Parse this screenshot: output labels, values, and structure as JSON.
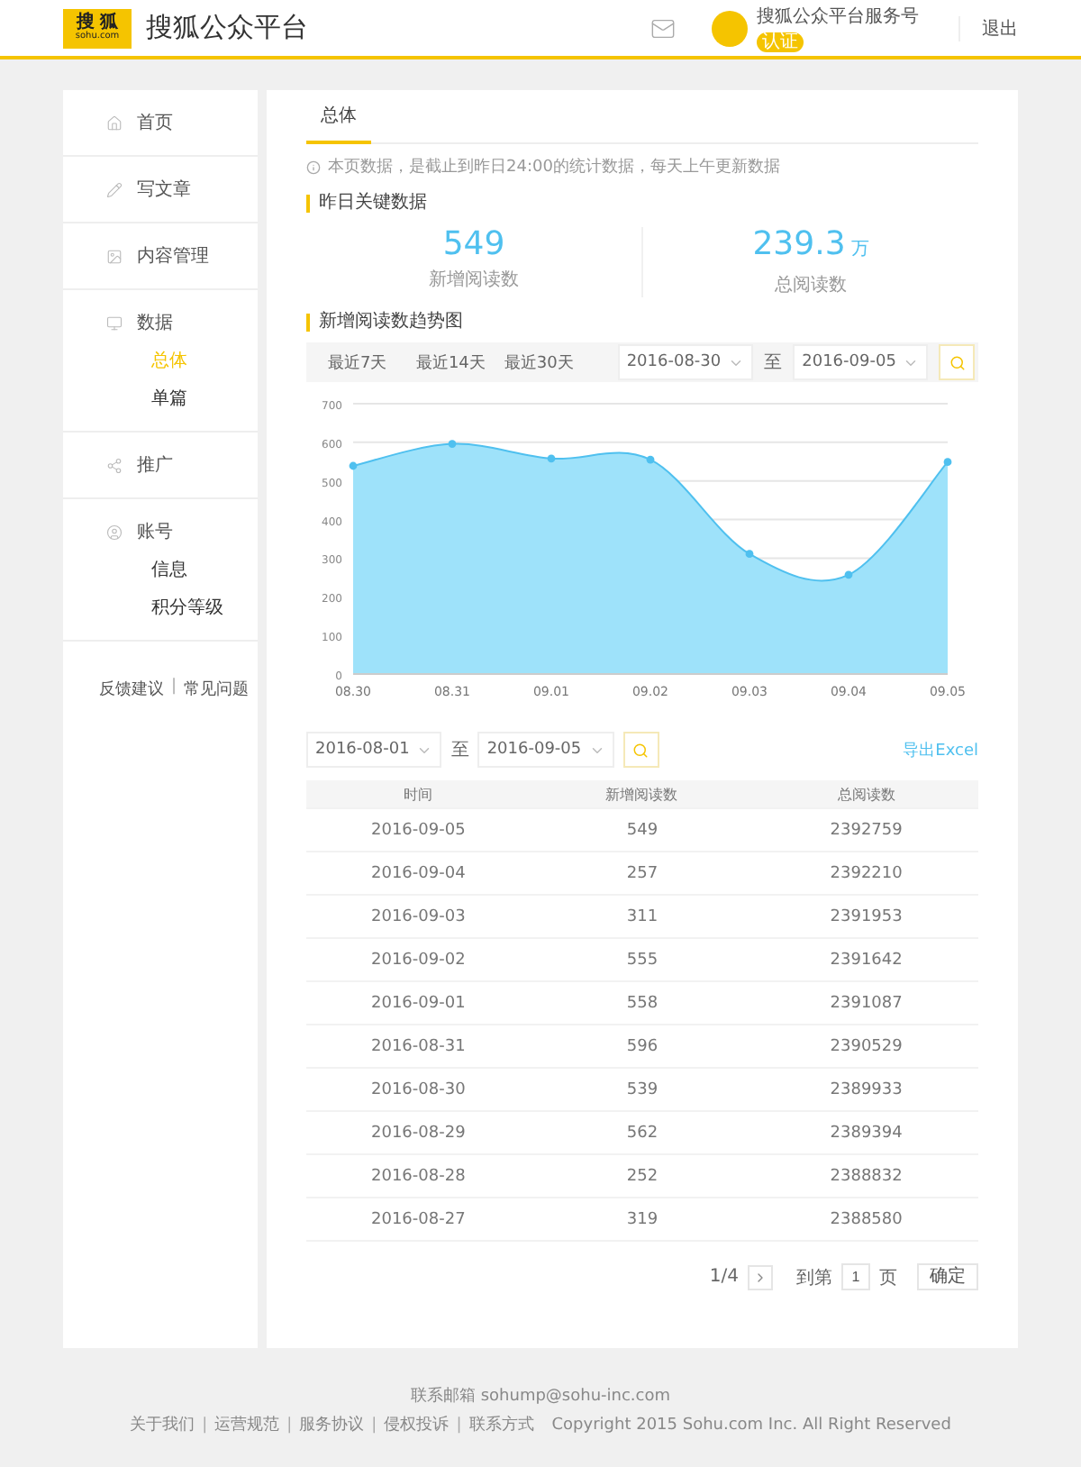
{
  "header": {
    "logo": {
      "top": "搜 狐",
      "bottom": "sohu.com"
    },
    "title": "搜狐公众平台",
    "account": {
      "name": "搜狐公众平台服务号",
      "badge": "认证"
    },
    "logout": "退出"
  },
  "sidebar": {
    "items": [
      {
        "label": "首页",
        "selected": false
      },
      {
        "label": "写文章",
        "selected": false
      },
      {
        "label": "内容管理",
        "selected": false
      },
      {
        "label": "数据",
        "selected": false,
        "children": [
          {
            "label": "总体",
            "selected": true
          },
          {
            "label": "单篇",
            "selected": false
          }
        ]
      },
      {
        "label": "推广",
        "selected": false
      },
      {
        "label": "账号",
        "selected": false,
        "children": [
          {
            "label": "信息",
            "selected": false
          },
          {
            "label": "积分等级",
            "selected": false
          }
        ]
      }
    ],
    "links": [
      "反馈建议",
      "常见问题"
    ],
    "separator": "|"
  },
  "tabs": [
    {
      "label": "总体",
      "selected": true
    }
  ],
  "notice": "本页数据，是截止到昨日24:00的统计数据，每天上午更新数据",
  "key_data": {
    "heading": "昨日关键数据",
    "stats": [
      {
        "value": "549",
        "label": "新增阅读数"
      },
      {
        "value": "239.3",
        "unit": "万",
        "label": "总阅读数"
      }
    ]
  },
  "trend": {
    "heading": "新增阅读数趋势图",
    "quick_ranges": [
      "最近7天",
      "最近14天",
      "最近30天"
    ],
    "from": "2016-08-30",
    "separator": "至",
    "to": "2016-09-05",
    "chart_data": {
      "type": "area",
      "categories": [
        "08.30",
        "08.31",
        "09.01",
        "09.02",
        "09.03",
        "09.04",
        "09.05"
      ],
      "series": [
        {
          "color": "#9ee2fa",
          "values": [
            539,
            596,
            558,
            555,
            311,
            257,
            549
          ]
        }
      ],
      "grid": true,
      "ylim": [
        0,
        700
      ],
      "yticks": [
        0,
        100,
        200,
        300,
        400,
        500,
        600,
        700
      ]
    }
  },
  "table_controls": {
    "from": "2016-08-01",
    "separator": "至",
    "to": "2016-09-05",
    "export": "导出Excel"
  },
  "table": {
    "columns": [
      "时间",
      "新增阅读数",
      "总阅读数"
    ],
    "rows": [
      [
        "2016-09-05",
        "549",
        "2392759"
      ],
      [
        "2016-09-04",
        "257",
        "2392210"
      ],
      [
        "2016-09-03",
        "311",
        "2391953"
      ],
      [
        "2016-09-02",
        "555",
        "2391642"
      ],
      [
        "2016-09-01",
        "558",
        "2391087"
      ],
      [
        "2016-08-31",
        "596",
        "2390529"
      ],
      [
        "2016-08-30",
        "539",
        "2389933"
      ],
      [
        "2016-08-29",
        "562",
        "2389394"
      ],
      [
        "2016-08-28",
        "252",
        "2388832"
      ],
      [
        "2016-08-27",
        "319",
        "2388580"
      ]
    ]
  },
  "pagination": {
    "page": "1/4",
    "goto": "到第",
    "input": "1",
    "unit": "页",
    "confirm": "确定"
  },
  "footer": {
    "contact": "联系邮箱 sohump@sohu-inc.com",
    "links": [
      "关于我们",
      "运营规范",
      "服务协议",
      "侵权投诉",
      "联系方式"
    ],
    "separator": "|",
    "copyright": "Copyright 2015 Sohu.com Inc. All Right Reserved"
  }
}
